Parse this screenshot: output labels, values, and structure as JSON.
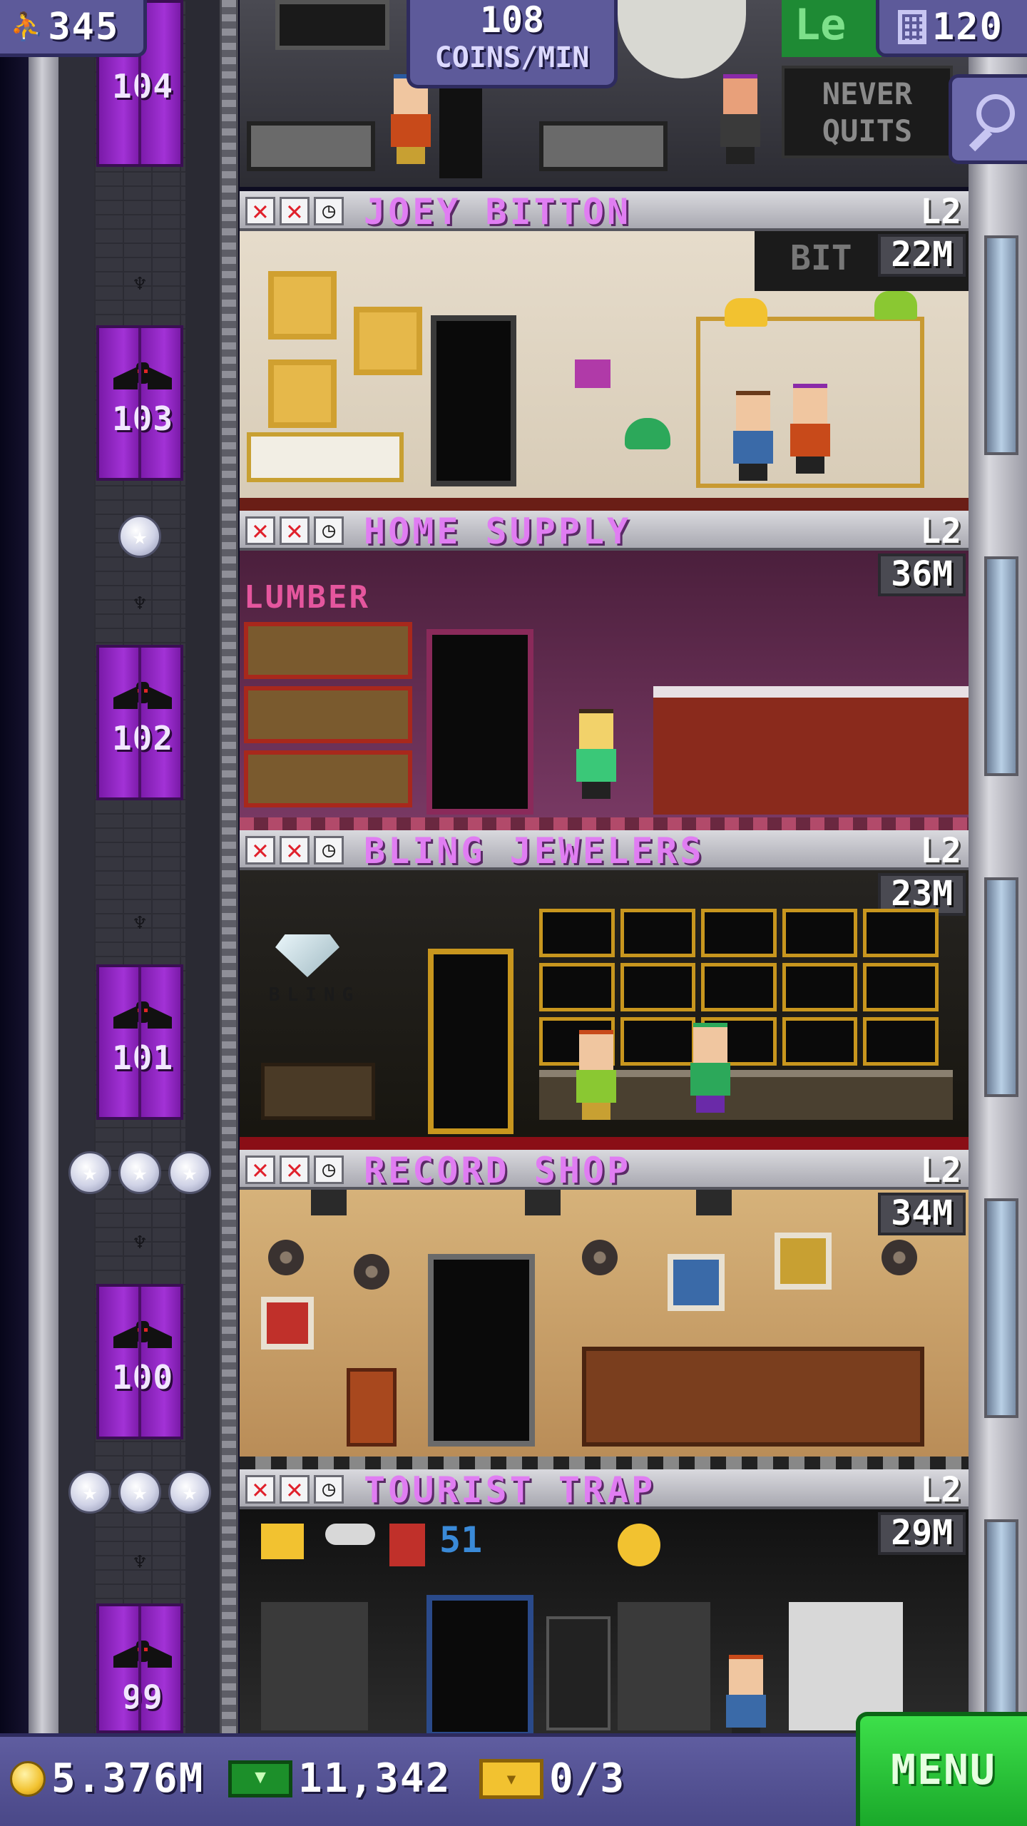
{
  "hud": {
    "population": "345",
    "coins_per_min_value": "108",
    "coins_per_min_label": "COINS/MIN",
    "floor_count": "120"
  },
  "top_floor": {
    "number": "104",
    "banner_line1": "NEVER",
    "banner_line2": "QUITS",
    "sign_partial": "Le"
  },
  "floors": [
    {
      "number": "103",
      "name": "JOEY BITTON",
      "level": "L2",
      "amount": "22M",
      "stars": 0,
      "sign": "BIT"
    },
    {
      "number": "102",
      "name": "HOME SUPPLY",
      "level": "L2",
      "amount": "36M",
      "stars": 1,
      "sign": "LUMBER"
    },
    {
      "number": "101",
      "name": "BLING JEWELERS",
      "level": "L2",
      "amount": "23M",
      "stars": 0,
      "sign": "BLING"
    },
    {
      "number": "100",
      "name": "RECORD SHOP",
      "level": "L2",
      "amount": "34M",
      "stars": 3
    },
    {
      "number": "99",
      "name": "TOURIST TRAP",
      "level": "L2",
      "amount": "29M",
      "stars": 3
    }
  ],
  "bottom_bar": {
    "coins": "5.376M",
    "bux": "11,342",
    "tickets": "0/3",
    "menu_label": "MENU"
  },
  "icons": {
    "population": "person-icon",
    "floors": "building-icon",
    "search": "magnifier-icon",
    "unstocked": "x-icon",
    "timer": "clock-icon",
    "star": "star-icon",
    "coin": "coin-icon",
    "bux": "bux-icon",
    "ticket": "golden-ticket-icon"
  },
  "colors": {
    "floor_name": "#e07df2",
    "elevator": "#a232d6",
    "menu_button": "#2ec83b",
    "hud_panel": "#5d5a9a"
  }
}
